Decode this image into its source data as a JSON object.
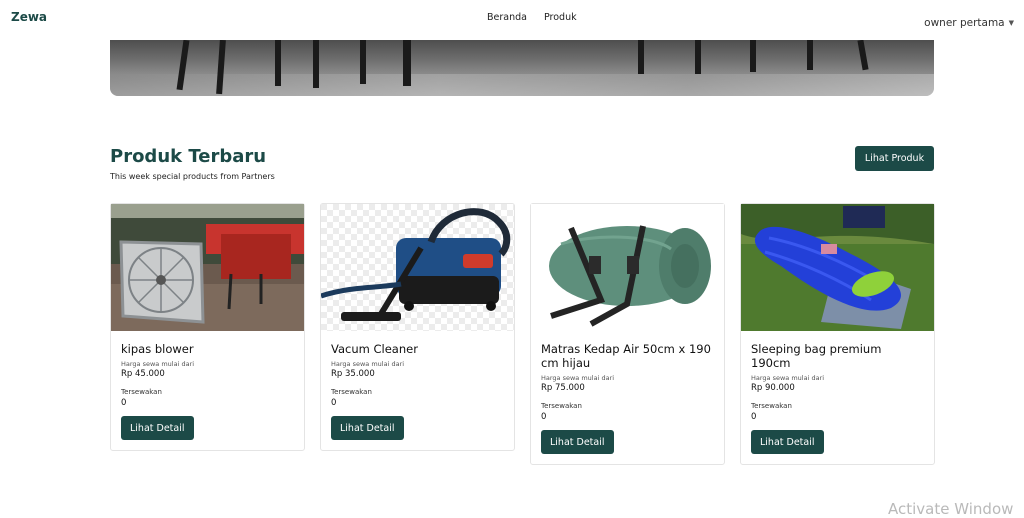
{
  "brand": "Zewa",
  "nav": {
    "items": [
      "Beranda",
      "Produk"
    ]
  },
  "user": {
    "name": "owner pertama"
  },
  "section": {
    "title": "Produk Terbaru",
    "subtitle": "This week special products from Partners",
    "cta": "Lihat Produk"
  },
  "products": [
    {
      "name": "kipas blower",
      "price_label": "Harga sewa mulai dari",
      "price": "Rp 45.000",
      "rented_label": "Tersewakan",
      "rented": "0",
      "button": "Lihat Detail",
      "image": "blower-fan-image"
    },
    {
      "name": "Vacum Cleaner",
      "price_label": "Harga sewa mulai dari",
      "price": "Rp 35.000",
      "rented_label": "Tersewakan",
      "rented": "0",
      "button": "Lihat Detail",
      "image": "vacuum-cleaner-image"
    },
    {
      "name": "Matras Kedap Air 50cm x 190 cm hijau",
      "price_label": "Harga sewa mulai dari",
      "price": "Rp 75.000",
      "rented_label": "Tersewakan",
      "rented": "0",
      "button": "Lihat Detail",
      "image": "rolled-mat-image"
    },
    {
      "name": "Sleeping bag premium 190cm",
      "price_label": "Harga sewa mulai dari",
      "price": "Rp 90.000",
      "rented_label": "Tersewakan",
      "rented": "0",
      "button": "Lihat Detail",
      "image": "sleeping-bag-image"
    }
  ],
  "watermark": "Activate Window",
  "colors": {
    "primary": "#1c4a47",
    "background": "#ffffff"
  }
}
